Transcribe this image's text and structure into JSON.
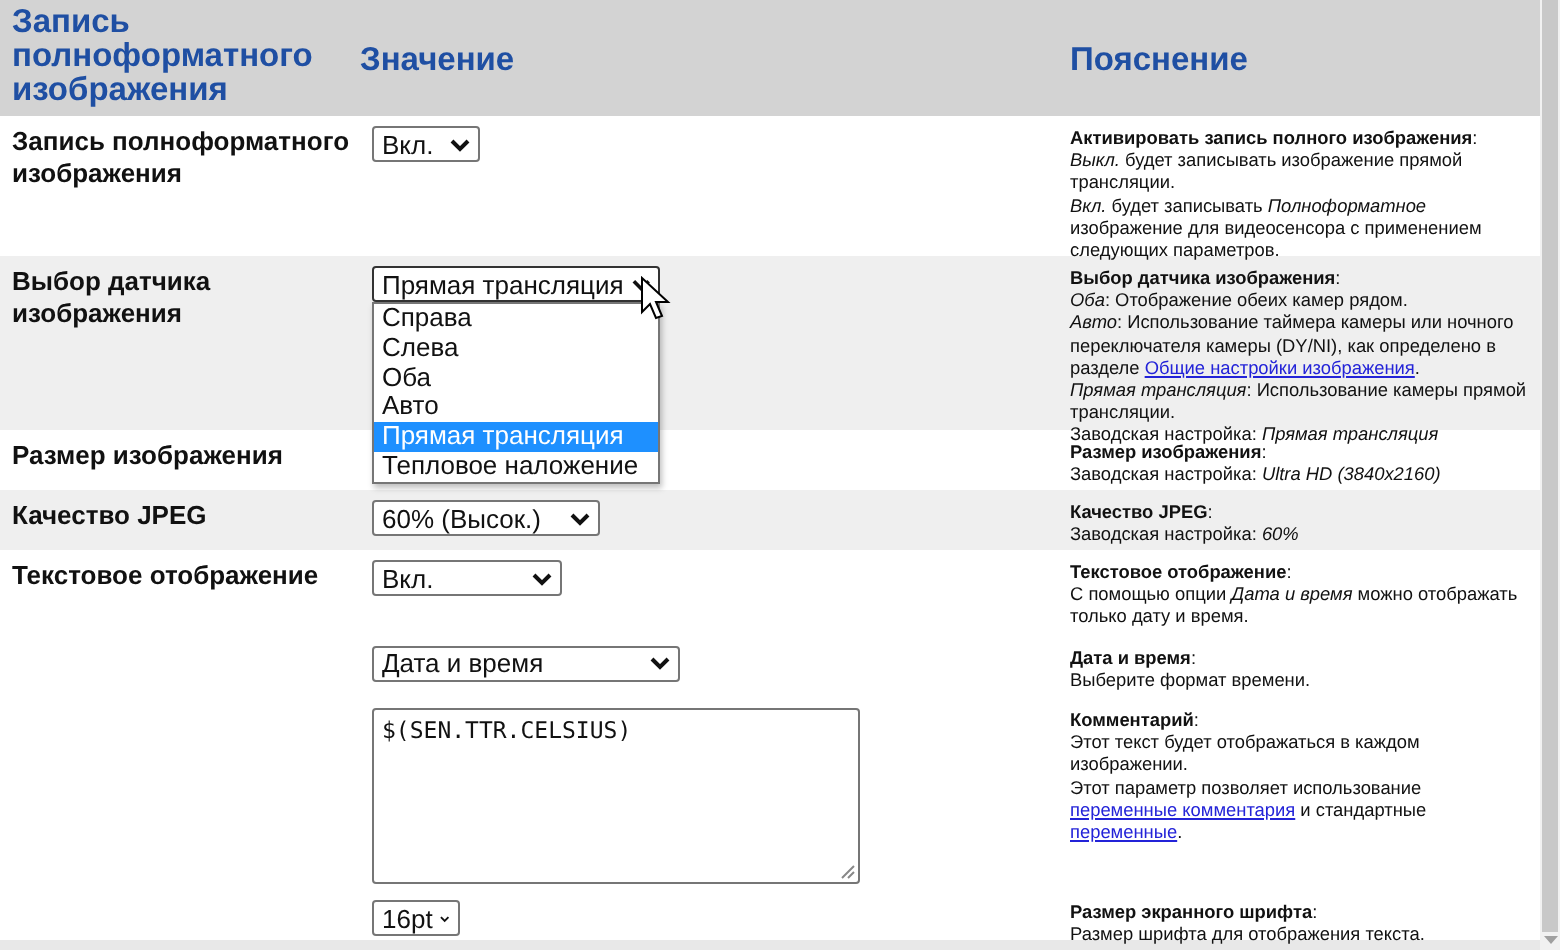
{
  "header": {
    "columns": [
      "Запись полноформатного изображения",
      "Значение",
      "Пояснение"
    ]
  },
  "rows": [
    {
      "label": "Запись полноформатного изображения",
      "items": [
        {
          "control": {
            "kind": "select",
            "value": "Вкл."
          },
          "note": [
            [
              {
                "text": "**Активировать запись полного изображения**:"
              }
            ],
            [
              {
                "text": "*Выкл.* будет записывать изображение прямой трансляции."
              }
            ],
            [
              {
                "text": "*Вкл.* будет записывать *Полноформатное* изображение для видеосенсора с применением следующих параметров."
              }
            ]
          ]
        }
      ]
    },
    {
      "label": "Выбор датчика изображения",
      "items": [
        {
          "control": {
            "kind": "select",
            "value": "Прямая трансляция",
            "open": true,
            "options": [
              {
                "label": "Справа",
                "selected": false
              },
              {
                "label": "Слева",
                "selected": false
              },
              {
                "label": "Оба",
                "selected": false
              },
              {
                "label": "Авто",
                "selected": false
              },
              {
                "label": "Прямая трансляция",
                "selected": true
              },
              {
                "label": "Тепловое наложение",
                "selected": false
              }
            ]
          },
          "note": [
            [
              {
                "text": "**Выбор датчика изображения**:"
              }
            ],
            [
              {
                "text": "*Оба*: Отображение обеих камер рядом."
              }
            ],
            [
              {
                "text": "*Авто*: Использование таймера камеры или ночного переключателя камеры (DY/NI), как определено в разделе "
              },
              {
                "link": "Общие настройки изображения"
              },
              {
                "text": "."
              }
            ],
            [
              {
                "text": "*Прямая трансляция*: Использование камеры прямой трансляции."
              }
            ],
            [
              {
                "text": "Заводская настройка: *Прямая трансляция*"
              }
            ]
          ]
        }
      ]
    },
    {
      "label": "Размер изображения",
      "items": [
        {
          "note": [
            [
              {
                "text": "**Размер изображения**:"
              }
            ],
            [
              {
                "text": "Заводская настройка: *Ultra HD (3840x2160)*"
              }
            ]
          ]
        }
      ]
    },
    {
      "label": "Качество JPEG",
      "items": [
        {
          "control": {
            "kind": "select",
            "value": "60% (Высок.)"
          },
          "note": [
            [
              {
                "text": "**Качество JPEG**:"
              }
            ],
            [
              {
                "text": "Заводская настройка: *60%*"
              }
            ]
          ]
        }
      ]
    },
    {
      "label": "Текстовое отображение",
      "items": [
        {
          "control": {
            "kind": "select",
            "value": "Вкл."
          },
          "note": [
            [
              {
                "text": "**Текстовое отображение**:"
              }
            ],
            [
              {
                "text": "С помощью опции *Дата и время* можно отображать только дату и время."
              }
            ]
          ]
        },
        {
          "control": {
            "kind": "select",
            "value": "Дата и время"
          },
          "note": [
            [
              {
                "text": "**Дата и время**:"
              }
            ],
            [
              {
                "text": "Выберите формат времени."
              }
            ]
          ]
        },
        {
          "control": {
            "kind": "textarea",
            "value": "$(SEN.TTR.CELSIUS)"
          },
          "note": [
            [
              {
                "text": "**Комментарий**:"
              }
            ],
            [
              {
                "text": "Этот текст будет отображаться в каждом изображении."
              }
            ],
            [
              {
                "text": "Этот параметр позволяет использование "
              },
              {
                "link": "переменные комментария"
              },
              {
                "text": " и стандартные "
              },
              {
                "link": "переменные"
              },
              {
                "text": "."
              }
            ]
          ]
        },
        {
          "control": {
            "kind": "select",
            "value": "16pt"
          },
          "note": [
            [
              {
                "text": "**Размер экранного шрифта**:"
              }
            ],
            [
              {
                "text": "Размер шрифта для отображения текста."
              }
            ]
          ]
        }
      ]
    }
  ]
}
